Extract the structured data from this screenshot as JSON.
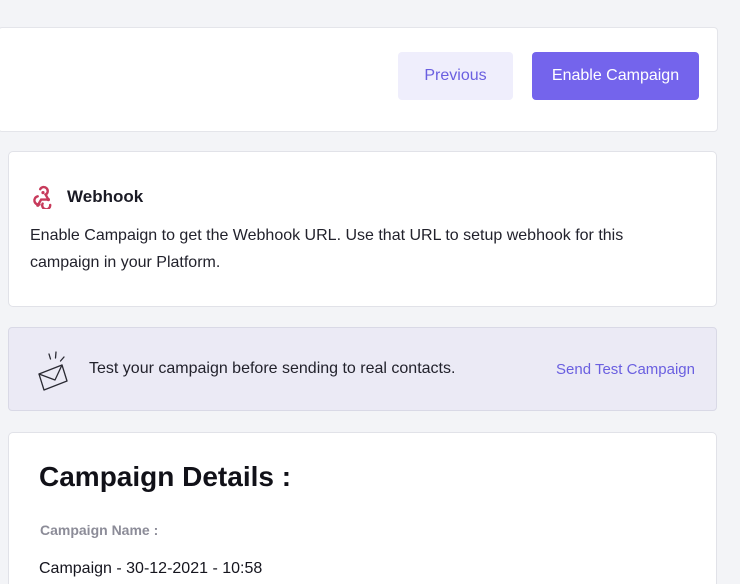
{
  "toolbar": {
    "previous_label": "Previous",
    "enable_label": "Enable Campaign"
  },
  "webhook": {
    "icon": "webhook-icon",
    "title": "Webhook",
    "description": "Enable Campaign to get the Webhook URL. Use that URL to setup webhook for this campaign in your Platform."
  },
  "test_banner": {
    "icon": "envelope-icon",
    "text": "Test your campaign before sending to real contacts.",
    "link_label": "Send Test Campaign"
  },
  "details": {
    "title": "Campaign Details :",
    "name_label": "Campaign Name :",
    "name_value": "Campaign - 30-12-2021 - 10:58"
  },
  "colors": {
    "accent": "#7464ec",
    "accent_light": "#efeefc",
    "banner_bg": "#ebeaf5",
    "webhook_red": "#c73a5b"
  }
}
